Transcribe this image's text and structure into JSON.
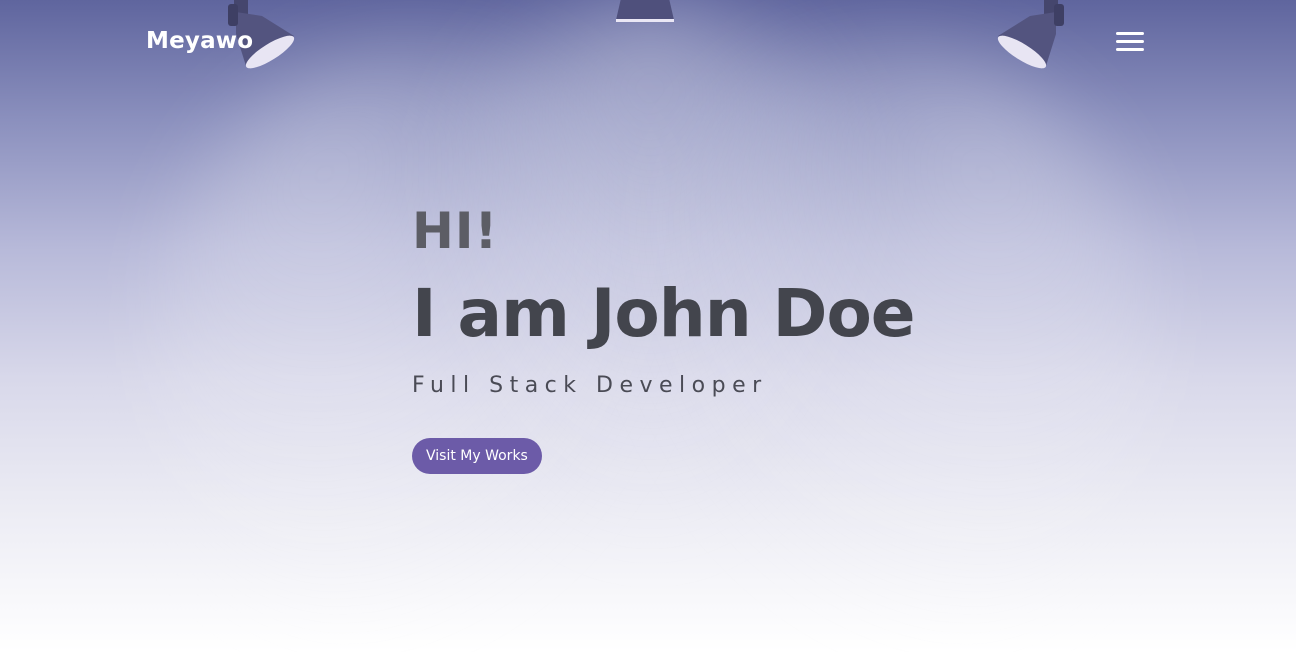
{
  "navbar": {
    "brand": "Meyawo",
    "menu_icon": "hamburger-menu-icon"
  },
  "hero": {
    "greeting": "HI!",
    "name": "I am John Doe",
    "role": "Full Stack Developer",
    "cta_label": "Visit My Works"
  },
  "decor": {
    "lamp_icon": "spotlight-lamp-icon"
  },
  "colors": {
    "accent": "#6c5ba8",
    "lamp": "#4f4f7a",
    "background_top": "#5f659e",
    "background_bottom": "#ffffff",
    "heading_text": "#43454d"
  }
}
